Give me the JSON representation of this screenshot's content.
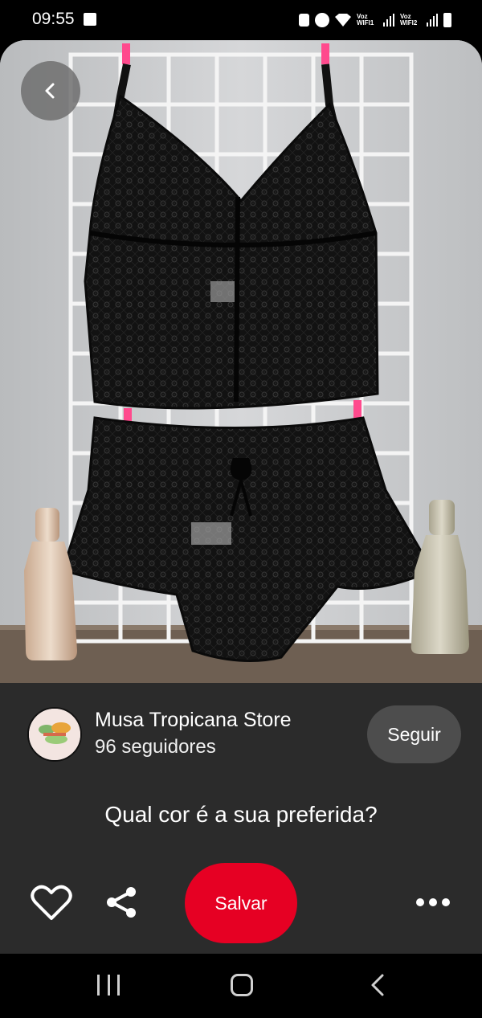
{
  "status_bar": {
    "time": "09:55",
    "network_1": "Voz WIFI1",
    "network_2": "Voz WIFI2",
    "icons": [
      "gallery-icon",
      "lock-icon",
      "alarm-icon",
      "wifi-icon",
      "signal-icon",
      "battery-icon"
    ]
  },
  "pin": {
    "image_description": "black lace bralette and lace shorts hanging on white wire grid",
    "back_icon": "chevron-left-icon"
  },
  "creator": {
    "name": "Musa Tropicana Store",
    "followers": "96 seguidores",
    "follow_label": "Seguir"
  },
  "question": "Qual cor é a sua preferida?",
  "actions": {
    "save_label": "Salvar",
    "like_icon": "heart-icon",
    "share_icon": "share-icon",
    "more_icon": "more-horizontal-icon"
  },
  "colors": {
    "save_red": "#e60023",
    "sheet_bg": "#2b2b2b",
    "follow_bg": "#4d4d4d"
  },
  "nav_bar": {
    "icons": [
      "recent-apps-icon",
      "home-icon",
      "back-icon"
    ]
  }
}
